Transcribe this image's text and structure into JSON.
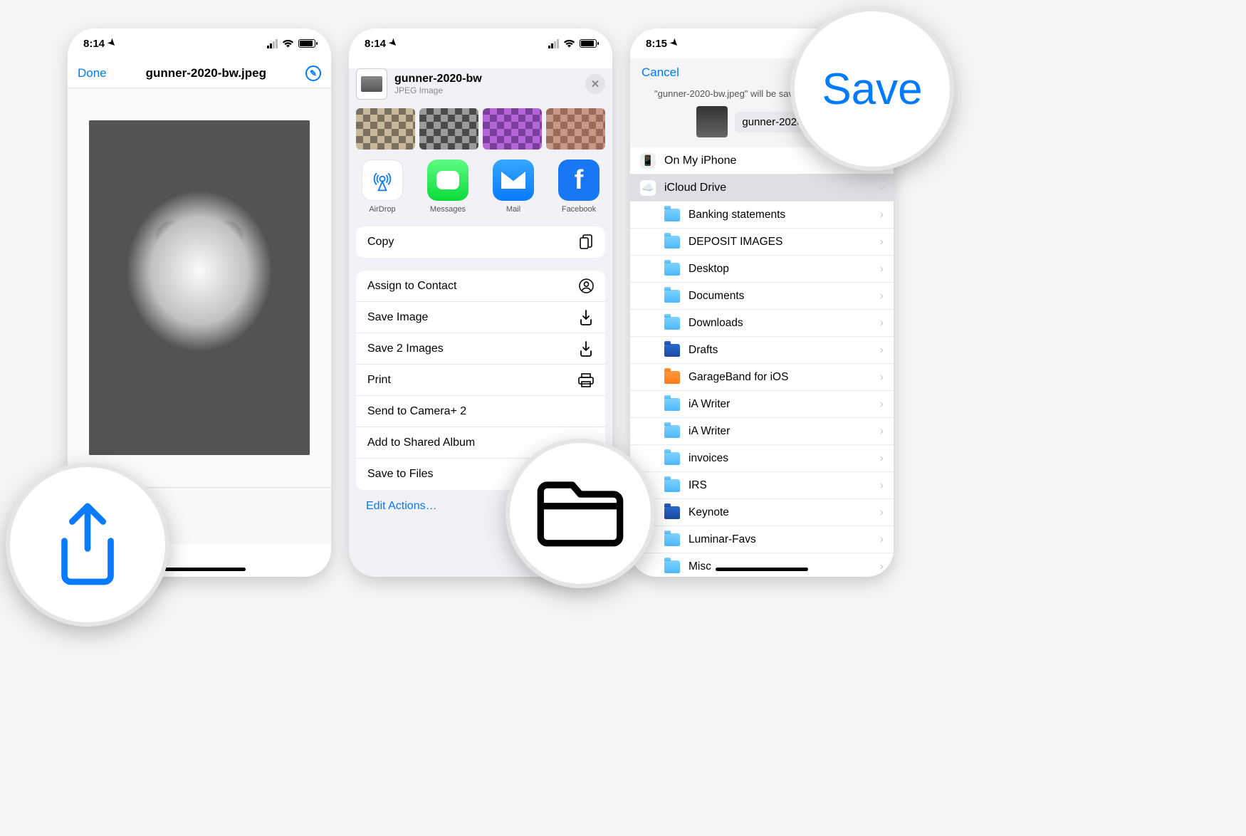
{
  "phone1": {
    "time": "8:14",
    "done": "Done",
    "title": "gunner-2020-bw.jpeg"
  },
  "phone2": {
    "time": "8:14",
    "filename": "gunner-2020-bw",
    "filetype": "JPEG Image",
    "apps": {
      "airdrop": "AirDrop",
      "messages": "Messages",
      "mail": "Mail",
      "facebook": "Facebook"
    },
    "actions": {
      "copy": "Copy",
      "assign": "Assign to Contact",
      "saveImage": "Save Image",
      "save2": "Save 2 Images",
      "print": "Print",
      "sendCamera": "Send to Camera+ 2",
      "sharedAlbum": "Add to Shared Album",
      "saveFiles": "Save to Files"
    },
    "editActions": "Edit Actions…"
  },
  "phone3": {
    "time": "8:15",
    "cancel": "Cancel",
    "save": "Save",
    "message": "\"gunner-2020-bw.jpeg\" will be saved to iCloud Drive.",
    "rename": "gunner-2020-bw",
    "locations": {
      "onMyIphone": "On My iPhone",
      "icloud": "iCloud Drive"
    },
    "folders": [
      "Banking statements",
      "DEPOSIT IMAGES",
      "Desktop",
      "Documents",
      "Downloads",
      "Drafts",
      "GarageBand for iOS",
      "iA Writer",
      "iA Writer",
      "invoices",
      "IRS",
      "Keynote",
      "Luminar-Favs",
      "Misc"
    ]
  },
  "callouts": {
    "save": "Save"
  }
}
